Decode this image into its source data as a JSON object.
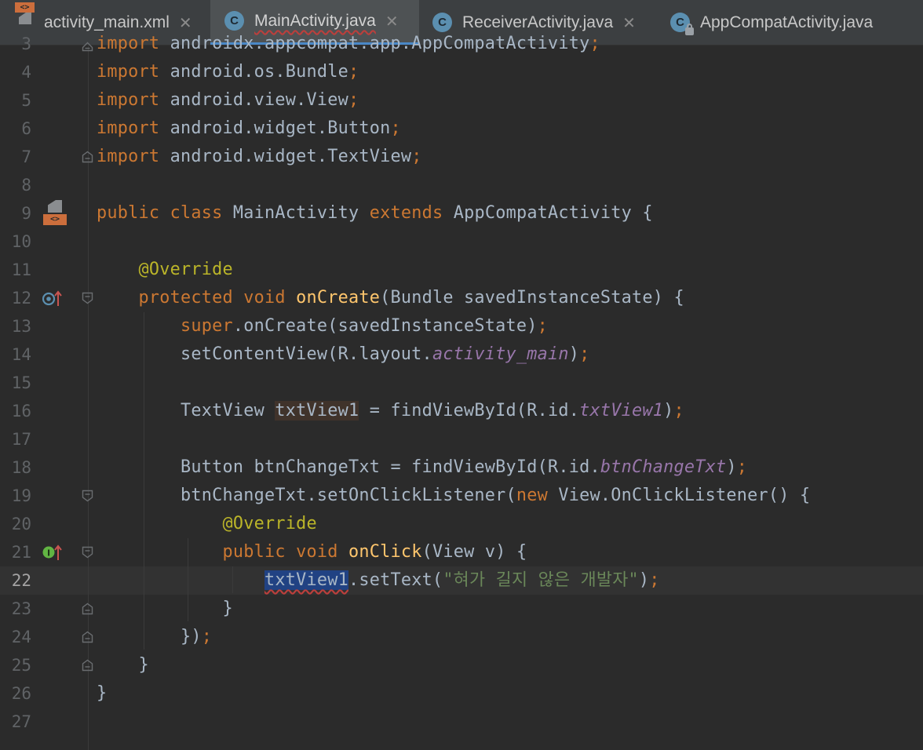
{
  "tabs": [
    {
      "label": "activity_main.xml",
      "icon": "xml-layout-file-icon",
      "active": false
    },
    {
      "label": "MainActivity.java",
      "icon": "java-class-icon",
      "active": true
    },
    {
      "label": "ReceiverActivity.java",
      "icon": "java-class-icon",
      "active": false
    },
    {
      "label": "AppCompatActivity.java",
      "icon": "java-class-locked-icon",
      "active": false
    }
  ],
  "icons": {
    "class_letter": "C",
    "xml_tag": "<>",
    "close": "✕",
    "implements": "I"
  },
  "current_line": 22,
  "editor": {
    "lines": [
      {
        "n": "3",
        "tokens": [
          {
            "k": "kw",
            "t": "import"
          },
          {
            "t": " androidx.appcompat.app.AppCompatActivity"
          },
          {
            "k": "kw",
            "t": ";"
          }
        ]
      },
      {
        "n": "4",
        "tokens": [
          {
            "k": "kw",
            "t": "import"
          },
          {
            "t": " android.os.Bundle"
          },
          {
            "k": "kw",
            "t": ";"
          }
        ]
      },
      {
        "n": "5",
        "tokens": [
          {
            "k": "kw",
            "t": "import"
          },
          {
            "t": " android.view.View"
          },
          {
            "k": "kw",
            "t": ";"
          }
        ]
      },
      {
        "n": "6",
        "tokens": [
          {
            "k": "kw",
            "t": "import"
          },
          {
            "t": " android.widget.Button"
          },
          {
            "k": "kw",
            "t": ";"
          }
        ]
      },
      {
        "n": "7",
        "tokens": [
          {
            "k": "kw",
            "t": "import"
          },
          {
            "t": " android.widget.TextView"
          },
          {
            "k": "kw",
            "t": ";"
          }
        ]
      },
      {
        "n": "8",
        "tokens": []
      },
      {
        "n": "9",
        "tokens": [
          {
            "k": "kw",
            "t": "public class "
          },
          {
            "t": "MainActivity "
          },
          {
            "k": "kw",
            "t": "extends "
          },
          {
            "t": "AppCompatActivity {"
          }
        ]
      },
      {
        "n": "10",
        "tokens": []
      },
      {
        "n": "11",
        "tokens": [
          {
            "t": "    "
          },
          {
            "k": "ann",
            "t": "@Override"
          }
        ]
      },
      {
        "n": "12",
        "tokens": [
          {
            "t": "    "
          },
          {
            "k": "kw",
            "t": "protected void "
          },
          {
            "k": "fn",
            "t": "onCreate"
          },
          {
            "t": "(Bundle savedInstanceState) {"
          }
        ]
      },
      {
        "n": "13",
        "tokens": [
          {
            "t": "        "
          },
          {
            "k": "kw",
            "t": "super"
          },
          {
            "t": ".onCreate(savedInstanceState)"
          },
          {
            "k": "kw",
            "t": ";"
          }
        ]
      },
      {
        "n": "14",
        "tokens": [
          {
            "t": "        setContentView(R.layout."
          },
          {
            "k": "fld",
            "t": "activity_main"
          },
          {
            "t": ")"
          },
          {
            "k": "kw",
            "t": ";"
          }
        ]
      },
      {
        "n": "15",
        "tokens": []
      },
      {
        "n": "16",
        "tokens": [
          {
            "t": "        TextView "
          },
          {
            "k": "hl-read",
            "t": "txtView1"
          },
          {
            "t": " = findViewById(R.id."
          },
          {
            "k": "fld",
            "t": "txtView1"
          },
          {
            "t": ")"
          },
          {
            "k": "kw",
            "t": ";"
          }
        ]
      },
      {
        "n": "17",
        "tokens": []
      },
      {
        "n": "18",
        "tokens": [
          {
            "t": "        Button btnChangeTxt = findViewById(R.id."
          },
          {
            "k": "fld",
            "t": "btnChangeTxt"
          },
          {
            "t": ")"
          },
          {
            "k": "kw",
            "t": ";"
          }
        ]
      },
      {
        "n": "19",
        "tokens": [
          {
            "t": "        btnChangeTxt.setOnClickListener("
          },
          {
            "k": "kw",
            "t": "new "
          },
          {
            "t": "View.OnClickListener() {"
          }
        ]
      },
      {
        "n": "20",
        "tokens": [
          {
            "t": "            "
          },
          {
            "k": "ann",
            "t": "@Override"
          }
        ]
      },
      {
        "n": "21",
        "tokens": [
          {
            "t": "            "
          },
          {
            "k": "kw",
            "t": "public void "
          },
          {
            "k": "fn",
            "t": "onClick"
          },
          {
            "t": "(View v) {"
          }
        ]
      },
      {
        "n": "22",
        "tokens": [
          {
            "t": "                "
          },
          {
            "k": "hl-sel",
            "t": "txtView1"
          },
          {
            "t": ".setText("
          },
          {
            "k": "str",
            "t": "\"혀가 길지 않은 개발자\""
          },
          {
            "t": ")"
          },
          {
            "k": "kw",
            "t": ";"
          }
        ]
      },
      {
        "n": "23",
        "tokens": [
          {
            "t": "            }"
          }
        ]
      },
      {
        "n": "24",
        "tokens": [
          {
            "t": "        })"
          },
          {
            "k": "kw",
            "t": ";"
          }
        ]
      },
      {
        "n": "25",
        "tokens": [
          {
            "t": "    }"
          }
        ]
      },
      {
        "n": "26",
        "tokens": [
          {
            "t": "}"
          }
        ]
      },
      {
        "n": "27",
        "tokens": []
      }
    ]
  }
}
